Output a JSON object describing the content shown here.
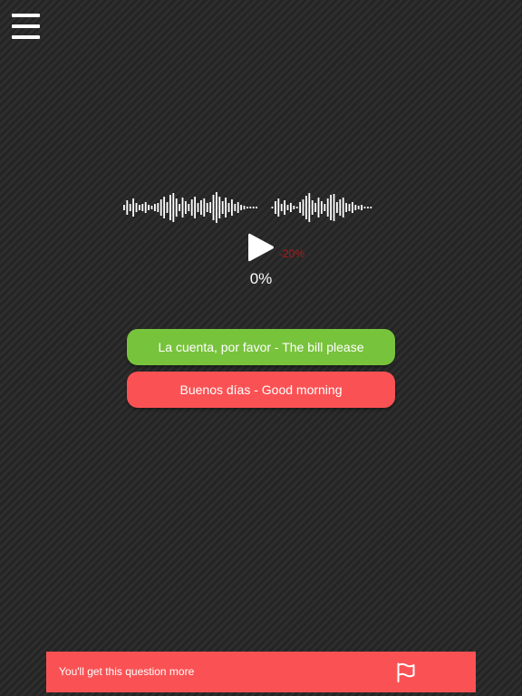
{
  "header": {
    "menu_icon": "hamburger-menu-icon"
  },
  "player": {
    "play_icon": "play-icon",
    "speed_label": "-20%",
    "progress_label": "0%",
    "progress": 0
  },
  "answers": [
    {
      "label": "La cuenta, por favor - The bill please",
      "state": "correct",
      "color": "#78c33c"
    },
    {
      "label": "Buenos días - Good morning",
      "state": "wrong",
      "color": "#fa5254"
    }
  ],
  "banner": {
    "text": "You'll get this question more",
    "flag_icon": "flag-icon",
    "color": "#fa5254"
  },
  "colors": {
    "background": "#2b2b2b",
    "speed_text": "#b01818"
  }
}
